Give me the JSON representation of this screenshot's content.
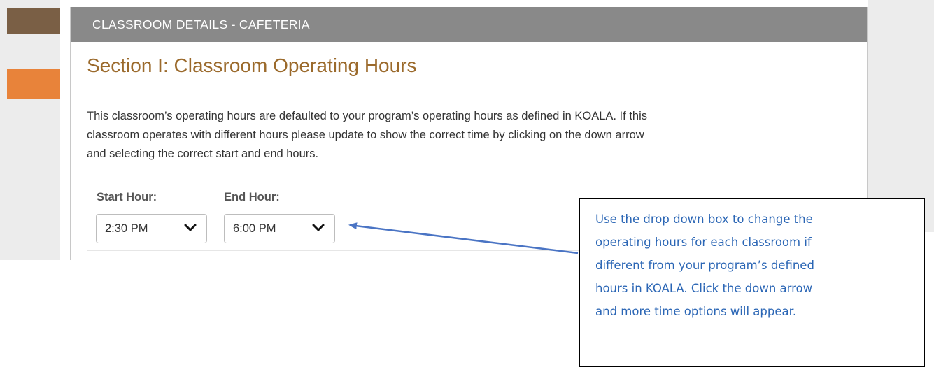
{
  "panel": {
    "header_title": "CLASSROOM DETAILS - CAFETERIA"
  },
  "section": {
    "title": "Section I: Classroom Operating Hours",
    "description_lines": [
      "This classroom’s operating hours are defaulted to your program’s operating hours as defined in KOALA. If this",
      "classroom operates with different hours please update to show the correct time by clicking on the down arrow",
      "and selecting the correct start and end hours."
    ]
  },
  "start_hour": {
    "label": "Start Hour:",
    "value": "2:30 PM",
    "icon": "chevron-down-icon"
  },
  "end_hour": {
    "label": "End Hour:",
    "value": "6:00 PM",
    "icon": "chevron-down-icon"
  },
  "callout": {
    "lines": [
      "Use the drop down box to change the",
      "operating hours for each classroom if",
      "different from your program’s defined",
      "hours in KOALA. Click the down arrow",
      "and more time options will appear."
    ]
  },
  "colors": {
    "header_bg": "#898989",
    "title_color": "#9b6a2c",
    "nav_brown": "#7a5f45",
    "nav_orange": "#e8833a",
    "callout_text": "#2b66b5",
    "arrow": "#4a74c4"
  }
}
